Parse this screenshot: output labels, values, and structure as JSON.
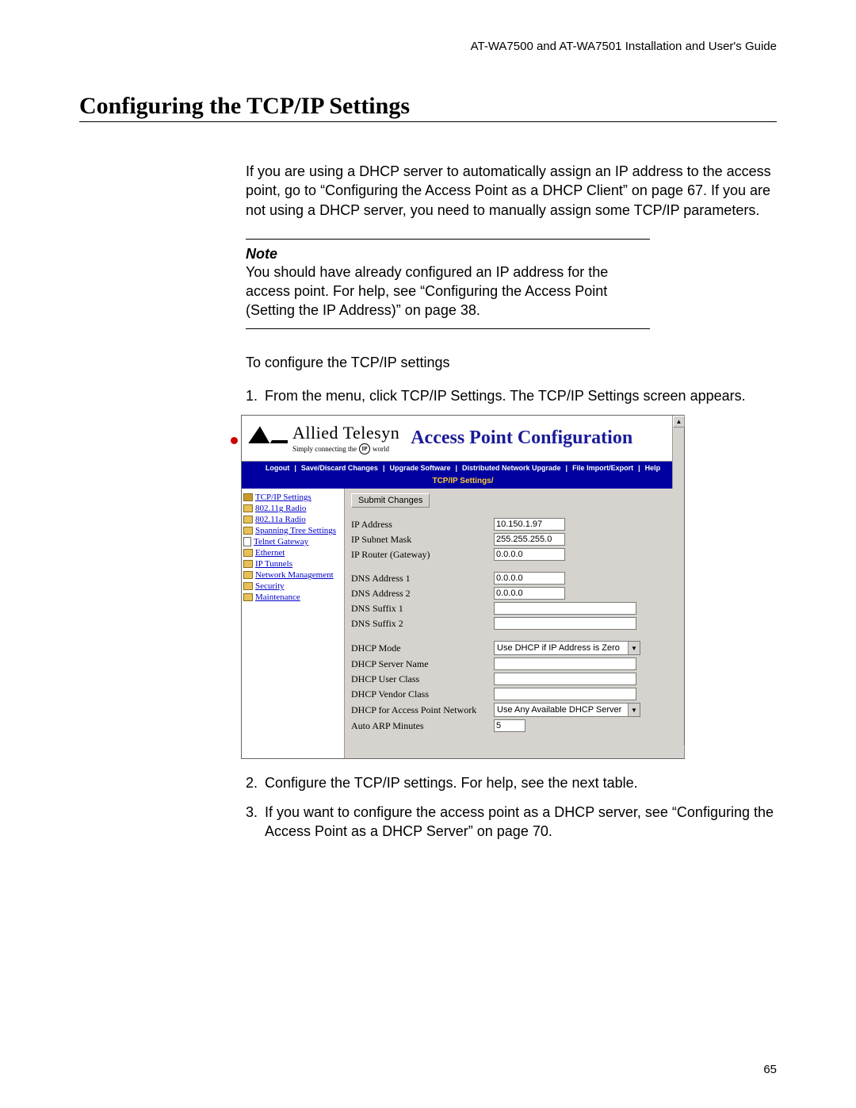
{
  "header": "AT-WA7500 and AT-WA7501 Installation and User's Guide",
  "title": "Configuring the TCP/IP Settings",
  "intro": "If you are using a DHCP server to automatically assign an IP address to the access point, go to “Configuring the Access Point as a DHCP Client” on page 67. If you are not using a DHCP server, you need to manually assign some TCP/IP parameters.",
  "note_label": "Note",
  "note_body": "You should have already configured an IP address for the access point. For help, see “Configuring the Access Point (Setting the IP Address)” on page 38.",
  "to_configure": "To configure the TCP/IP settings",
  "steps": {
    "s1": "From the menu, click TCP/IP Settings. The TCP/IP Settings screen appears.",
    "s2": "Configure the TCP/IP settings. For help, see the next table.",
    "s3": "If you want to configure the access point as a DHCP server, see “Configuring the Access Point as a DHCP Server” on page 70."
  },
  "page_num": "65",
  "screenshot": {
    "brand": "Allied Telesyn",
    "tagline_pre": "Simply connecting the",
    "tagline_ip": "IP",
    "tagline_post": "world",
    "conf_title": "Access Point Configuration",
    "menu": [
      "Logout",
      "Save/Discard Changes",
      "Upgrade Software",
      "Distributed Network Upgrade",
      "File Import/Export",
      "Help"
    ],
    "breadcrumb": "TCP/IP Settings/",
    "nav": [
      "TCP/IP Settings",
      "802.11g Radio",
      "802.11a Radio",
      "Spanning Tree Settings",
      "Telnet Gateway",
      "Ethernet",
      "IP Tunnels",
      "Network Management",
      "Security",
      "Maintenance"
    ],
    "submit": "Submit Changes",
    "fields": {
      "ip_addr_l": "IP Address",
      "ip_addr_v": "10.150.1.97",
      "subnet_l": "IP Subnet Mask",
      "subnet_v": "255.255.255.0",
      "router_l": "IP Router (Gateway)",
      "router_v": "0.0.0.0",
      "dns1_l": "DNS Address 1",
      "dns1_v": "0.0.0.0",
      "dns2_l": "DNS Address 2",
      "dns2_v": "0.0.0.0",
      "dnss1_l": "DNS Suffix 1",
      "dnss1_v": "",
      "dnss2_l": "DNS Suffix 2",
      "dnss2_v": "",
      "dhcp_mode_l": "DHCP Mode",
      "dhcp_mode_v": "Use DHCP if IP Address is Zero",
      "dhcp_srv_l": "DHCP Server Name",
      "dhcp_srv_v": "",
      "dhcp_usr_l": "DHCP User Class",
      "dhcp_usr_v": "",
      "dhcp_vnd_l": "DHCP Vendor Class",
      "dhcp_vnd_v": "",
      "dhcp_apn_l": "DHCP for Access Point Network",
      "dhcp_apn_v": "Use Any Available DHCP Server",
      "arp_l": "Auto ARP Minutes",
      "arp_v": "5"
    }
  }
}
